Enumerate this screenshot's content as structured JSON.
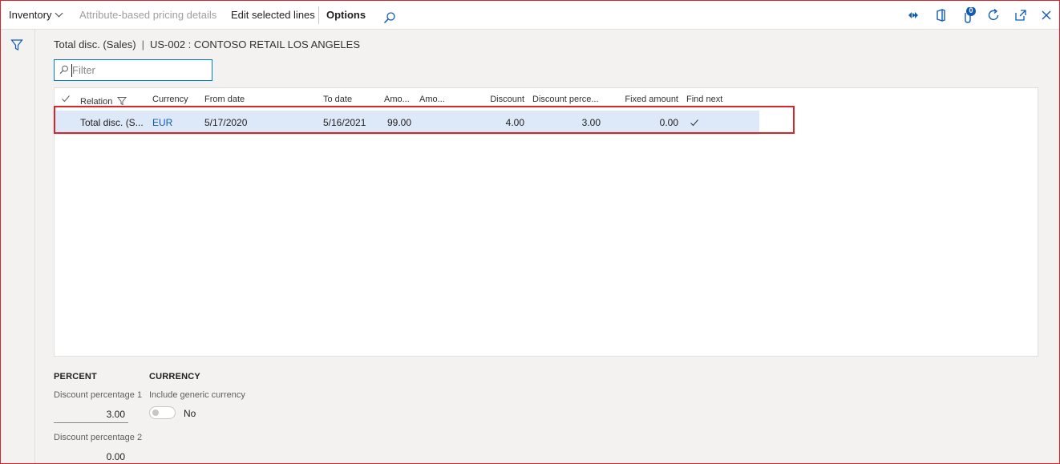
{
  "toolbar": {
    "inventory_label": "Inventory",
    "attribute_pricing_label": "Attribute-based pricing details",
    "edit_selected_label": "Edit selected lines",
    "options_label": "Options",
    "notification_count": "0"
  },
  "caption": {
    "record_type": "Total disc. (Sales)",
    "separator": "|",
    "customer": "US-002 : CONTOSO RETAIL LOS ANGELES"
  },
  "filter": {
    "placeholder": "Filter"
  },
  "grid": {
    "headers": {
      "relation": "Relation",
      "currency": "Currency",
      "from_date": "From date",
      "to_date": "To date",
      "amount1": "Amo...",
      "amount2": "Amo...",
      "discount": "Discount",
      "discount_percent": "Discount perce...",
      "fixed_amount": "Fixed amount",
      "find_next": "Find next"
    },
    "rows": [
      {
        "relation": "Total disc. (S...",
        "currency": "EUR",
        "from_date": "5/17/2020",
        "to_date": "5/16/2021",
        "amount1": "99.00",
        "amount2": "",
        "discount": "4.00",
        "discount_percent": "3.00",
        "fixed_amount": "0.00",
        "find_next": true
      }
    ]
  },
  "details": {
    "percent_group": "PERCENT",
    "currency_group": "CURRENCY",
    "discount_pct1_label": "Discount percentage 1",
    "discount_pct1_value": "3.00",
    "discount_pct2_label": "Discount percentage 2",
    "discount_pct2_value": "0.00",
    "include_generic_label": "Include generic currency",
    "include_generic_value": "No"
  },
  "colors": {
    "accent": "#0078d4",
    "highlight_border": "#d9252a",
    "selected_row": "#dde8f8"
  }
}
